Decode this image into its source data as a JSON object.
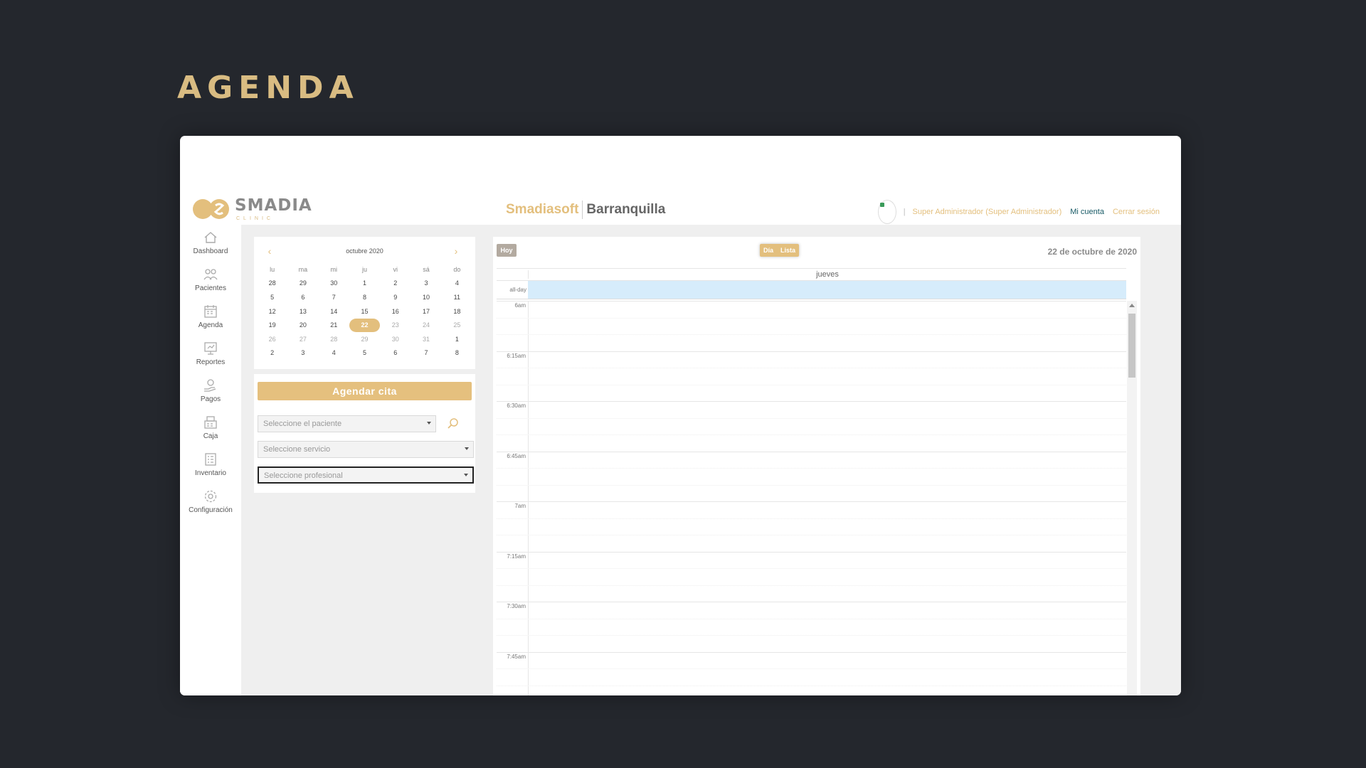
{
  "slide": {
    "title": "AGENDA"
  },
  "header": {
    "logo_name": "SMADIA",
    "logo_sub": "CLINIC",
    "brand_primary": "Smadiasoft",
    "brand_location": "Barranquilla",
    "user_separator": "|",
    "user_name": "Super Administrador (Super Administrador)",
    "my_account": "Mi cuenta",
    "logout": "Cerrar sesión"
  },
  "sidebar": {
    "items": [
      {
        "label": "Dashboard",
        "icon": "home-icon"
      },
      {
        "label": "Pacientes",
        "icon": "patients-icon"
      },
      {
        "label": "Agenda",
        "icon": "agenda-icon"
      },
      {
        "label": "Reportes",
        "icon": "reports-icon"
      },
      {
        "label": "Pagos",
        "icon": "payments-icon"
      },
      {
        "label": "Caja",
        "icon": "cash-register-icon"
      },
      {
        "label": "Inventario",
        "icon": "inventory-icon"
      },
      {
        "label": "Configuración",
        "icon": "gear-icon"
      }
    ]
  },
  "mini_calendar": {
    "prev": "‹",
    "next": "›",
    "month": "octubre 2020",
    "weekdays": [
      "lu",
      "ma",
      "mi",
      "ju",
      "vi",
      "sá",
      "do"
    ],
    "weeks": [
      [
        {
          "d": "28"
        },
        {
          "d": "29"
        },
        {
          "d": "30"
        },
        {
          "d": "1"
        },
        {
          "d": "2"
        },
        {
          "d": "3"
        },
        {
          "d": "4"
        }
      ],
      [
        {
          "d": "5"
        },
        {
          "d": "6"
        },
        {
          "d": "7"
        },
        {
          "d": "8"
        },
        {
          "d": "9"
        },
        {
          "d": "10"
        },
        {
          "d": "11"
        }
      ],
      [
        {
          "d": "12"
        },
        {
          "d": "13"
        },
        {
          "d": "14"
        },
        {
          "d": "15"
        },
        {
          "d": "16"
        },
        {
          "d": "17"
        },
        {
          "d": "18"
        }
      ],
      [
        {
          "d": "19"
        },
        {
          "d": "20"
        },
        {
          "d": "21"
        },
        {
          "d": "22",
          "today": true
        },
        {
          "d": "23",
          "muted": true
        },
        {
          "d": "24",
          "muted": true
        },
        {
          "d": "25",
          "muted": true
        }
      ],
      [
        {
          "d": "26",
          "muted": true
        },
        {
          "d": "27",
          "muted": true
        },
        {
          "d": "28",
          "muted": true
        },
        {
          "d": "29",
          "muted": true
        },
        {
          "d": "30",
          "muted": true
        },
        {
          "d": "31",
          "muted": true
        },
        {
          "d": "1"
        }
      ],
      [
        {
          "d": "2"
        },
        {
          "d": "3"
        },
        {
          "d": "4"
        },
        {
          "d": "5"
        },
        {
          "d": "6"
        },
        {
          "d": "7"
        },
        {
          "d": "8"
        }
      ]
    ]
  },
  "booking": {
    "book_label": "Agendar cita",
    "patient_placeholder": "Seleccione el paciente",
    "service_placeholder": "Seleccione servicio",
    "professional_placeholder": "Seleccione profesional"
  },
  "day_view": {
    "today_label": "Hoy",
    "view_day": "Día",
    "view_list": "Lista",
    "date_title": "22 de octubre de 2020",
    "weekday": "jueves",
    "allday_label": "all-day",
    "time_labels": [
      "6am",
      "6:15am",
      "6:30am",
      "6:45am",
      "7am",
      "7:15am",
      "7:30am",
      "7:45am"
    ]
  },
  "colors": {
    "accent": "#e3bf7d",
    "background": "#24272d",
    "allday": "#d6ecfb"
  }
}
